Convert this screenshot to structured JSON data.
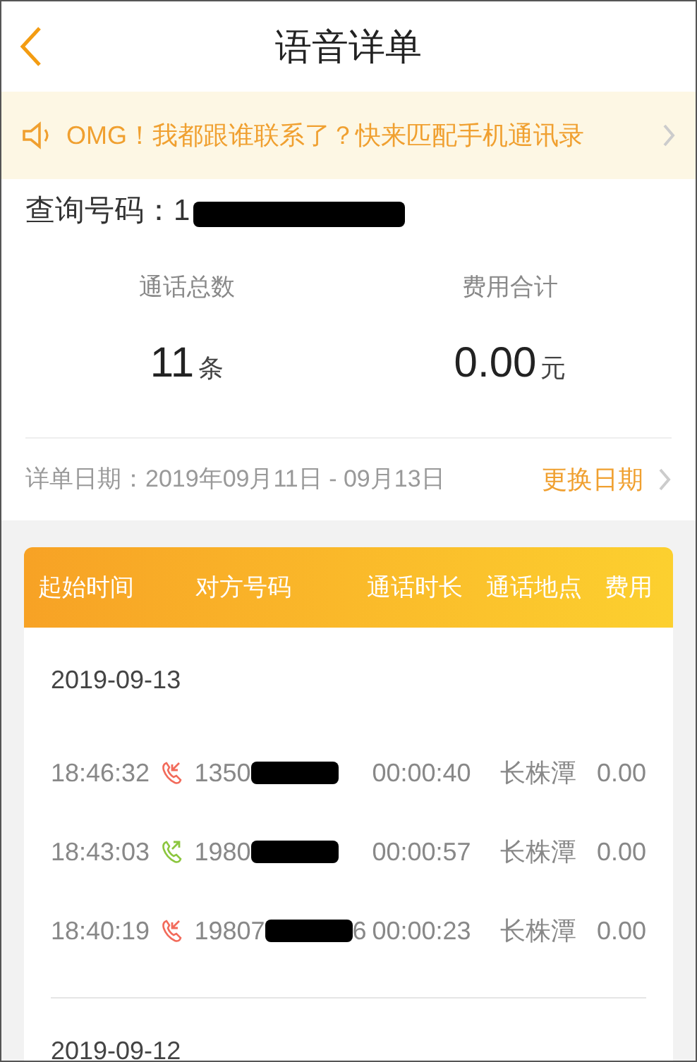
{
  "header": {
    "title": "语音详单"
  },
  "banner": {
    "text": "OMG！我都跟谁联系了？快来匹配手机通讯录"
  },
  "query": {
    "label": "查询号码：",
    "number": "1",
    "redacted": true
  },
  "stats": [
    {
      "label": "通话总数",
      "value": "11",
      "unit": "条"
    },
    {
      "label": "费用合计",
      "value": "0.00",
      "unit": "元"
    }
  ],
  "date_range": {
    "label": "详单日期：",
    "value": "2019年09月11日 - 09月13日",
    "action": "更换日期"
  },
  "table": {
    "columns": [
      "起始时间",
      "对方号码",
      "通话时长",
      "通话地点",
      "费用"
    ],
    "groups": [
      {
        "date": "2019-09-13",
        "rows": [
          {
            "time": "18:46:32",
            "kind": "incoming",
            "number": "1350",
            "duration": "00:00:40",
            "location": "长株潭",
            "fee": "0.00"
          },
          {
            "time": "18:43:03",
            "kind": "outgoing",
            "number": "1980",
            "duration": "00:00:57",
            "location": "长株潭",
            "fee": "0.00"
          },
          {
            "time": "18:40:19",
            "kind": "incoming",
            "number": "19807",
            "number_tail": "6",
            "duration": "00:00:23",
            "location": "长株潭",
            "fee": "0.00"
          }
        ]
      },
      {
        "date": "2019-09-12"
      }
    ]
  }
}
